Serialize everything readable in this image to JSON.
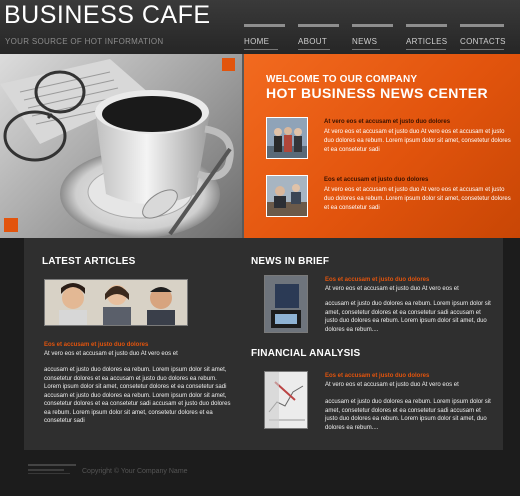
{
  "header": {
    "title": "BUSINESS CAFE",
    "tagline": "YOUR SOURCE OF HOT INFORMATION",
    "nav": [
      "HOME",
      "ABOUT",
      "NEWS",
      "ARTICLES",
      "CONTACTS"
    ]
  },
  "hero": {
    "welcome": "WELCOME TO OUR COMPANY",
    "headline": "HOT BUSINESS NEWS CENTER",
    "items": [
      {
        "title": "At vero eos et accusam et justo duo dolores",
        "text": "et justo duo dolores ea rebum. Lorem ipsum dolor sit amet, consetetur dolores et ea consetetur sadi",
        "lead": "At vero eos et accusam et justo duo At vero eos et accusam et justo duo dolores ea rebum. Lorem ipsum dolor sit amet, consetetur dolores et ea consetetur sadi"
      },
      {
        "title": "Eos et accusam et justo duo dolores",
        "lead": "At vero eos et accusam et justo duo At vero eos et accusam et justo duo dolores ea rebum. Lorem ipsum dolor sit amet, consetetur dolores et ea consetetur sadi"
      }
    ]
  },
  "latest": {
    "heading": "LATEST ARTICLES",
    "title": "Eos et accusam et justo duo dolores",
    "lead": "At vero eos et accusam et justo duo At vero eos et",
    "body": "accusam et justo duo dolores ea rebum. Lorem ipsum dolor sit amet, consetetur dolores et ea accusam et justo duo dolores ea rebum. Lorem ipsum dolor sit amet, consetetur dolores et ea consetetur sadi accusam et justo duo dolores ea rebum. Lorem ipsum dolor sit amet, consetetur dolores et ea consetetur sadi accusam et justo duo dolores ea rebum. Lorem ipsum dolor sit amet, consetetur dolores et ea consetetur sadi"
  },
  "news": {
    "heading": "NEWS IN BRIEF",
    "title": "Eos et accusam et justo duo dolores",
    "lead": "At vero eos et accusam et justo duo At vero eos et",
    "body": "accusam et justo duo dolores ea rebum. Lorem ipsum dolor sit amet, consetetur dolores et ea consetetur sadi accusam et justo duo dolores ea rebum. Lorem ipsum dolor sit amet, duo dolores ea rebum...."
  },
  "finance": {
    "heading": "FINANCIAL ANALYSIS",
    "title": "Eos et accusam et justo duo dolores",
    "lead": "At vero eos et accusam et justo duo At vero eos et",
    "body": "accusam et justo duo dolores ea rebum. Lorem ipsum dolor sit amet, consetetur dolores et ea consetetur sadi accusam et justo duo dolores ea rebum. Lorem ipsum dolor sit amet, duo dolores ea rebum...."
  },
  "footer": {
    "copyright": "Copyright © Your Company Name"
  },
  "colors": {
    "accent": "#e2540d",
    "background": "#1c1c1c",
    "panel": "#2f2f2f"
  }
}
